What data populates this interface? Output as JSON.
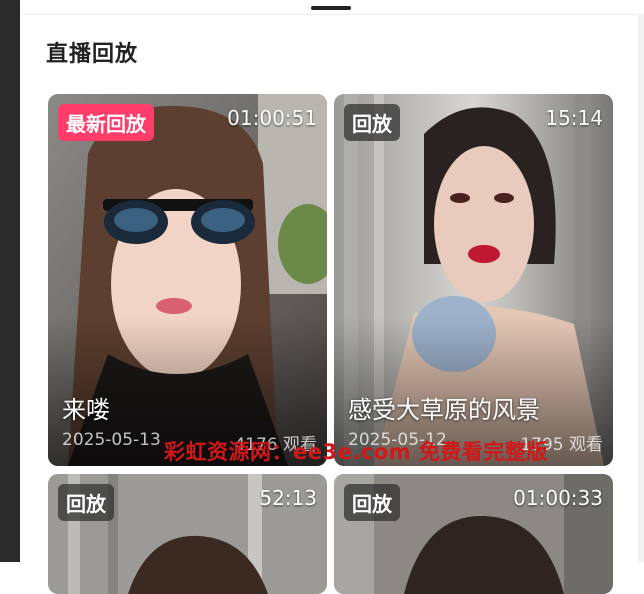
{
  "section": {
    "title": "直播回放"
  },
  "cards": [
    {
      "badge": "最新回放",
      "badge_type": "new",
      "duration": "01:00:51",
      "title": "来喽",
      "date": "2025-05-13",
      "views": "4176 观看"
    },
    {
      "badge": "回放",
      "badge_type": "replay",
      "duration": "15:14",
      "title": "感受大草原的风景",
      "date": "2025-05-12",
      "views": "1795 观看"
    },
    {
      "badge": "回放",
      "badge_type": "replay",
      "duration": "52:13"
    },
    {
      "badge": "回放",
      "badge_type": "replay",
      "duration": "01:00:33"
    }
  ],
  "watermark": "彩虹资源网：ee3e.com 免费看完整版",
  "colors": {
    "new_badge": "#ff3d6a",
    "watermark": "#d01818"
  }
}
